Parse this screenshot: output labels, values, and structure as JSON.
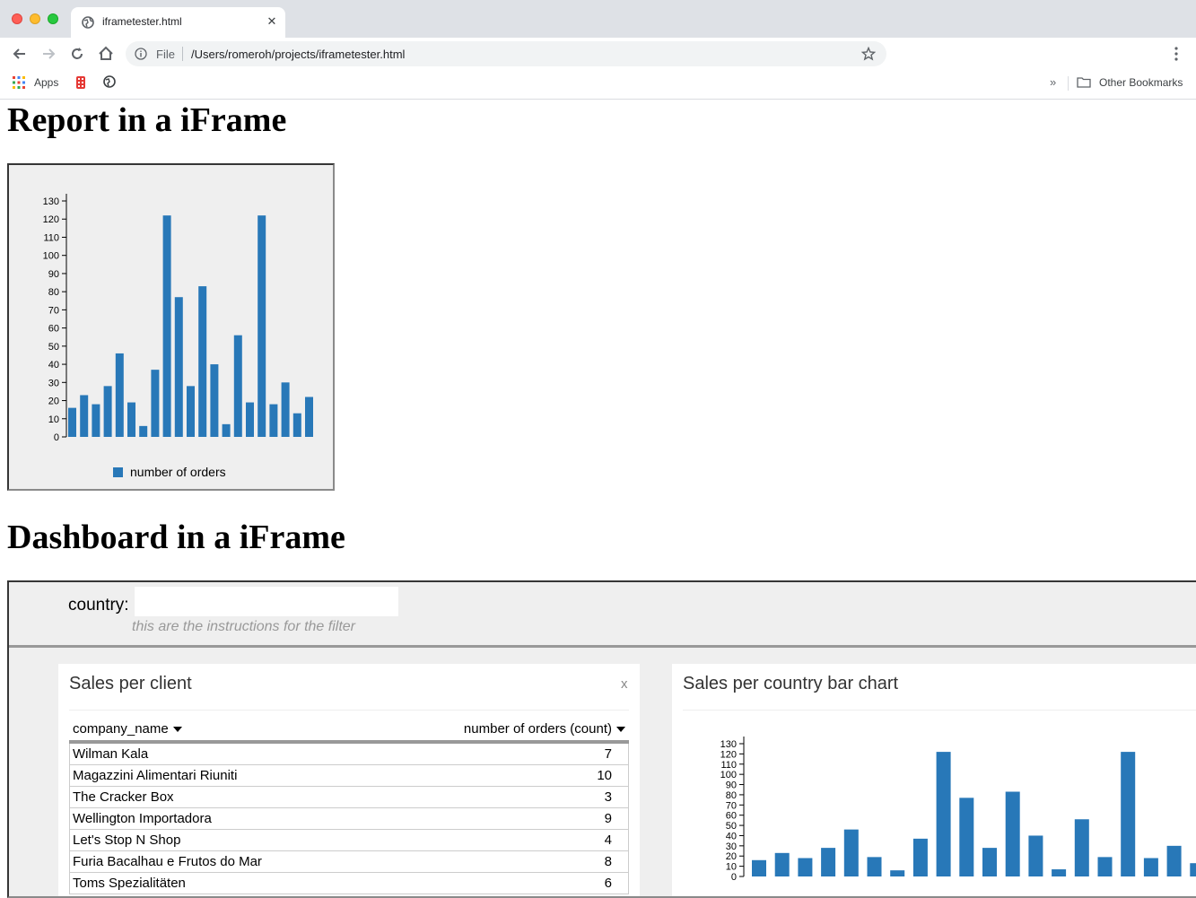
{
  "browser": {
    "tab_title": "iframetester.html",
    "tab_close": "✕",
    "omnibox_scheme": "File",
    "url": "/Users/romeroh/projects/iframetester.html",
    "bookmarks": {
      "apps_label": "Apps",
      "overflow": "»",
      "other_bookmarks": "Other Bookmarks"
    }
  },
  "page": {
    "report_heading": "Report in a iFrame",
    "dashboard_heading": "Dashboard in a iFrame"
  },
  "colors": {
    "bar": "#2878b8"
  },
  "filter": {
    "label": "country:",
    "value": "",
    "instructions": "this are the instructions for the filter"
  },
  "client_widget": {
    "title": "Sales per client",
    "close": "x",
    "columns": [
      "company_name",
      "number of orders (count)"
    ],
    "rows": [
      {
        "name": "Wilman Kala",
        "value": "7"
      },
      {
        "name": "Magazzini Alimentari Riuniti",
        "value": "10"
      },
      {
        "name": "The Cracker Box",
        "value": "3"
      },
      {
        "name": "Wellington Importadora",
        "value": "9"
      },
      {
        "name": "Let's Stop N Shop",
        "value": "4"
      },
      {
        "name": "Furia Bacalhau e Frutos do Mar",
        "value": "8"
      },
      {
        "name": "Toms Spezialitäten",
        "value": "6"
      }
    ]
  },
  "country_widget": {
    "title": "Sales per country bar chart"
  },
  "chart_data": [
    {
      "type": "bar",
      "title": "",
      "xlabel": "",
      "ylabel": "",
      "ylim": [
        0,
        130
      ],
      "yticks": [
        0,
        10,
        20,
        30,
        40,
        50,
        60,
        70,
        80,
        90,
        100,
        110,
        120,
        130
      ],
      "legend": "number of orders",
      "values": [
        16,
        23,
        18,
        28,
        46,
        19,
        6,
        37,
        122,
        77,
        28,
        83,
        40,
        7,
        56,
        19,
        122,
        18,
        30,
        13,
        22
      ]
    },
    {
      "type": "bar",
      "title": "",
      "xlabel": "",
      "ylabel": "",
      "ylim": [
        0,
        130
      ],
      "yticks": [
        0,
        10,
        20,
        30,
        40,
        50,
        60,
        70,
        80,
        90,
        100,
        110,
        120,
        130
      ],
      "values": [
        16,
        23,
        18,
        28,
        46,
        19,
        6,
        37,
        122,
        77,
        28,
        83,
        40,
        7,
        56,
        19,
        122,
        18,
        30,
        13
      ]
    }
  ]
}
